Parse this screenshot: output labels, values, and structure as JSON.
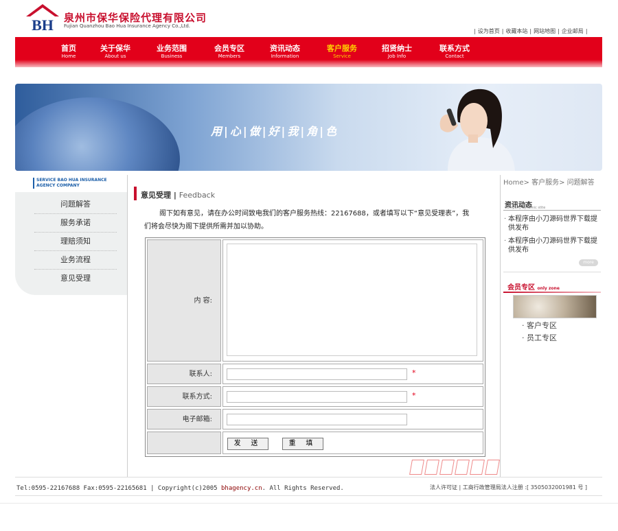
{
  "header": {
    "logo_text": "BH",
    "company_cn": "泉州市保华保险代理有限公司",
    "company_en": "Fujian Quanzhou Bao Hua Insurance Agency Co.,Ltd.",
    "top_links": [
      "设为首页",
      "收藏本站",
      "网站地图",
      "企业邮局"
    ]
  },
  "nav": [
    {
      "cn": "首页",
      "en": "Home"
    },
    {
      "cn": "关于保华",
      "en": "About us"
    },
    {
      "cn": "业务范围",
      "en": "Business"
    },
    {
      "cn": "会员专区",
      "en": "Members"
    },
    {
      "cn": "资讯动态",
      "en": "Information"
    },
    {
      "cn": "客户服务",
      "en": "Service",
      "active": true
    },
    {
      "cn": "招贤纳士",
      "en": "Job Info"
    },
    {
      "cn": "联系方式",
      "en": "Contact"
    }
  ],
  "banner": {
    "slogan": "用|心|做|好|我|角|色"
  },
  "sidebar": {
    "title_line1": "SERVICE BAO HUA INSURANCE",
    "title_line2": "AGENCY COMPANY",
    "items": [
      "问题解答",
      "服务承诺",
      "理赔须知",
      "业务流程",
      "意见受理"
    ]
  },
  "main": {
    "section_title_cn": "意见受理",
    "section_title_sep": "|",
    "section_title_en": "Feedback",
    "intro": "阁下如有意见，请在办公时间致电我们的客户服务热线：22167688，或者填写以下“意见受理表”，我们将会尽快为阁下提供所需并加以协助。",
    "form": {
      "content_label": "内 容:",
      "contact_label": "联系人:",
      "phone_label": "联系方式:",
      "email_label": "电子邮箱:",
      "required_mark": "*",
      "submit_label": "发 送",
      "reset_label": "重 填"
    }
  },
  "right": {
    "breadcrumb": "Home> 客户服务> 问题解答",
    "news_title": "资讯动态",
    "news_sub": "Company dynamic stite",
    "news": [
      "本程序由小刀源码世界下载提供发布",
      "本程序由小刀源码世界下载提供发布"
    ],
    "more_label": "more",
    "member_title": "会员专区",
    "member_title_en": "only zone",
    "member_links": [
      "客户专区",
      "员工专区"
    ]
  },
  "footer": {
    "left_prefix": "Tel:0595-22167688 Fax:0595-22165681 | Copyright(c)2005 ",
    "domain": "bhagency.cn",
    "left_suffix": ". All Rights Reserved.",
    "right": "法人许可证 | 工商行政管理局法人注册 :[ 3505032001981 号 ]"
  },
  "colors": {
    "brand_red": "#e2001a",
    "active_nav": "#ffd200",
    "link_blue": "#1b5ea8"
  }
}
